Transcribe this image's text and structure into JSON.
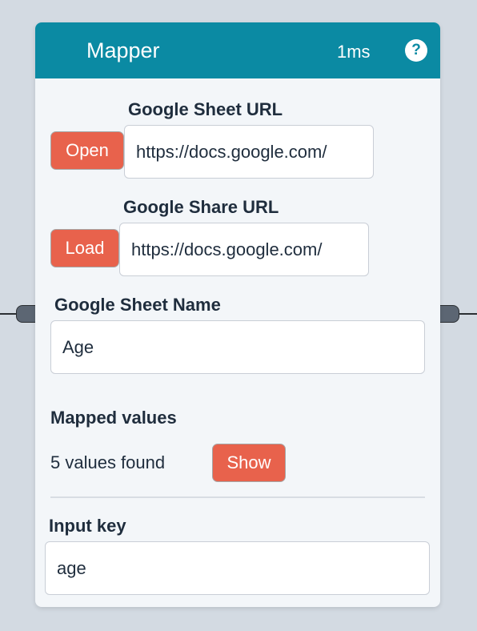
{
  "node": {
    "title": "Mapper",
    "timing": "1ms",
    "help_symbol": "?",
    "header_color": "#0b8aa3",
    "button_color": "#e8624c"
  },
  "sheet_url": {
    "label": "Google Sheet URL",
    "button_label": "Open",
    "value": "https://docs.google.com/"
  },
  "share_url": {
    "label": "Google Share URL",
    "button_label": "Load",
    "value": "https://docs.google.com/"
  },
  "sheet_name": {
    "label": "Google Sheet Name",
    "value": "Age"
  },
  "mapped": {
    "label": "Mapped values",
    "count_text": "5 values found",
    "button_label": "Show"
  },
  "input_key": {
    "label": "Input key",
    "value": "age"
  }
}
